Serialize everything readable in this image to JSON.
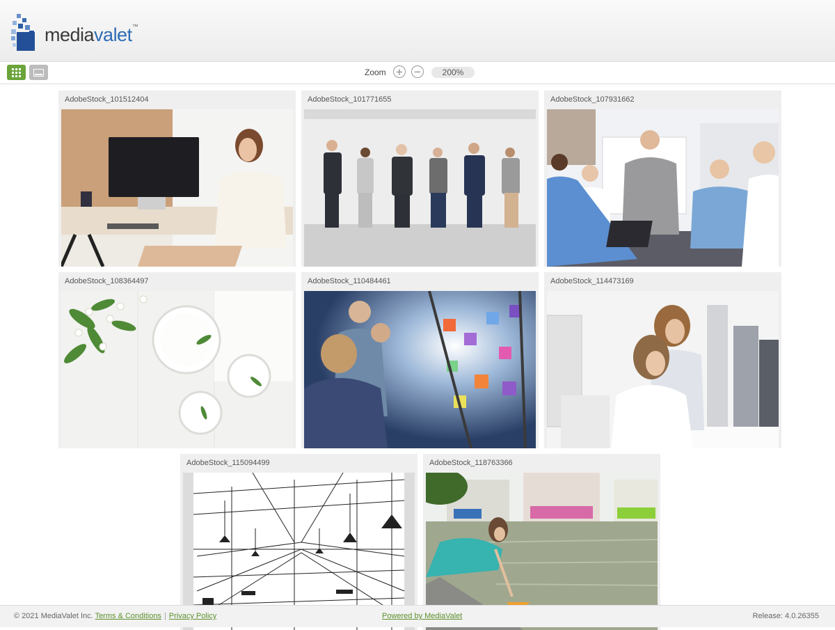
{
  "brand": {
    "name_part1": "media",
    "name_part2": "valet",
    "trademark": "™"
  },
  "toolbar": {
    "grid_view_icon": "grid-icon",
    "single_view_icon": "single-view-icon",
    "zoom_label": "Zoom",
    "zoom_in_icon": "plus-circle-icon",
    "zoom_out_icon": "minus-circle-icon",
    "zoom_value": "200%"
  },
  "gallery": {
    "items": [
      {
        "title": "AdobeStock_101512404"
      },
      {
        "title": "AdobeStock_101771655"
      },
      {
        "title": "AdobeStock_107931662"
      },
      {
        "title": "AdobeStock_108364497"
      },
      {
        "title": "AdobeStock_110484461"
      },
      {
        "title": "AdobeStock_114473169"
      },
      {
        "title": "AdobeStock_115094499"
      },
      {
        "title": "AdobeStock_118763366"
      }
    ]
  },
  "footer": {
    "copyright": "© 2021 MediaValet Inc.",
    "terms": "Terms & Conditions",
    "separator": "|",
    "privacy": "Privacy Policy",
    "powered": "Powered by MediaValet",
    "release": "Release: 4.0.26355"
  },
  "colors": {
    "accent_green": "#6aa43a",
    "link_green": "#5b8f2b",
    "brand_blue": "#2e6db4"
  }
}
